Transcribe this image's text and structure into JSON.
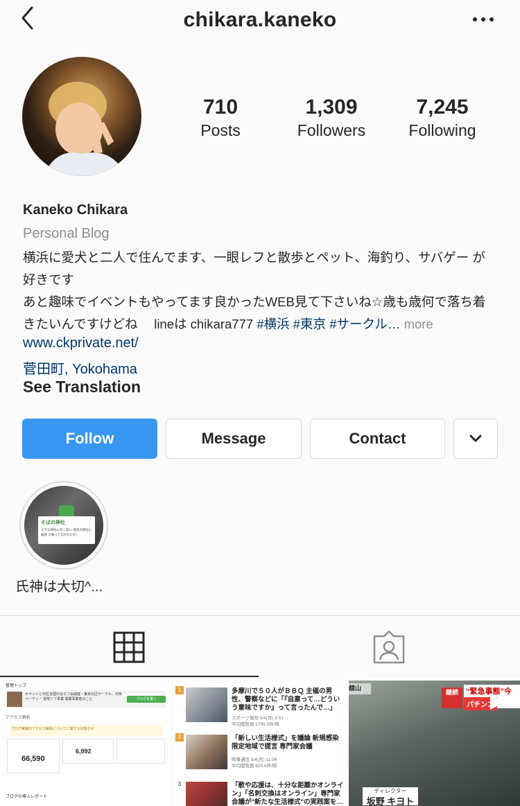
{
  "header": {
    "username": "chikara.kaneko",
    "back_icon": "chevron-left-icon",
    "more_icon": "ellipsis-icon"
  },
  "stats": [
    {
      "value": "710",
      "label": "Posts"
    },
    {
      "value": "1,309",
      "label": "Followers"
    },
    {
      "value": "7,245",
      "label": "Following"
    }
  ],
  "profile": {
    "name": "Kaneko Chikara",
    "category": "Personal Blog",
    "bio_line1": "横浜に愛犬と二人で住んでます、一眼レフと散歩とペット、海釣り、サバゲー が",
    "bio_line2": "好きです",
    "bio_line3": "あと趣味でイベントもやってます良かったWEB見て下さいね☆歳も歳何で落ち着",
    "bio_line4_text": "きたいんですけどね　 lineは chikara777 ",
    "bio_tag1": "#横浜",
    "bio_tag2": "#東京",
    "bio_tag3": "#サークル…",
    "bio_more": "more",
    "website": "www.ckprivate.net/",
    "location": "菅田町, Yokohama",
    "see_translation": "See Translation"
  },
  "actions": {
    "follow": "Follow",
    "message": "Message",
    "contact": "Contact",
    "dropdown_icon": "chevron-down-icon"
  },
  "highlights": [
    {
      "label": "氏神は大切^...",
      "cover_title": "そばの神社",
      "cover_text": "大きな神社に行く前に 地元の神社に挨拶 大事って言われたの！"
    }
  ],
  "tabs": {
    "grid_icon": "grid-icon",
    "tagged_icon": "tagged-person-icon"
  },
  "posts": {
    "post1": {
      "heading": "管理トップ",
      "summary": "キヤントと中区全国の合オフ会開催・東京北区サークル、元気ペーティー 遊地ソフ事業 開業事業者のこと",
      "button": "ブログを書く",
      "section": "アクセス解析",
      "notice": "プログ実装のアクセス解析についてに関するお知らせ",
      "big_stat_1": "66,590",
      "big_stat_2": "6,992",
      "footer": "ブログの導入レポート"
    },
    "post2": {
      "items": [
        {
          "rank": "1",
          "title": "多摩川で５０人がＢＢＱ 主催の男性、警察などに「『自粛って…どういう意味ですか』って言ったんで…」",
          "source": "スポーツ報知 5/4(月) 8:51",
          "views": "平均閲覧数 1795.5件/時"
        },
        {
          "rank": "2",
          "title": "「新しい生活様式」を議論 新規感染限定地域で提言 専門家会議",
          "source": "時事通信 5/4(月) 11:06",
          "views": "平均閲覧数 820.6件/時"
        },
        {
          "rank": "3",
          "title": "「歌や応援は、十分な距離かオンライン」「名刺交換はオンライン」専門家会議が\"新たな生活様式\"の実践案を…",
          "source": "",
          "views": ""
        }
      ]
    },
    "post3": {
      "caption_top": "“緊急事態”今月",
      "caption_red": "パチンコ",
      "tag_red": "継続",
      "location_tag": "舘山",
      "sub_top": "ディレクター",
      "sub_name": "坂野 キヨト"
    }
  }
}
